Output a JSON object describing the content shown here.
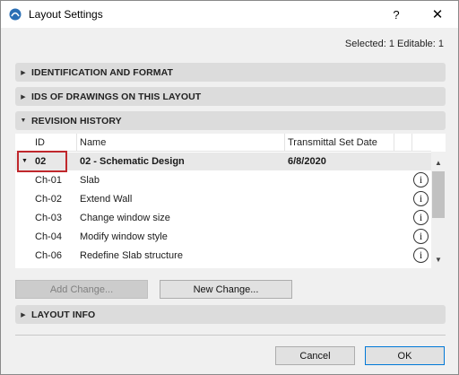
{
  "window": {
    "title": "Layout Settings",
    "help_label": "?",
    "close_label": "✕"
  },
  "selection_info": "Selected: 1 Editable: 1",
  "sections": [
    {
      "label": "IDENTIFICATION AND FORMAT",
      "expanded": false
    },
    {
      "label": "IDS OF DRAWINGS ON THIS LAYOUT",
      "expanded": false
    },
    {
      "label": "REVISION HISTORY",
      "expanded": true
    },
    {
      "label": "LAYOUT INFO",
      "expanded": false
    }
  ],
  "revision_table": {
    "columns": [
      "ID",
      "Name",
      "Transmittal Set Date"
    ],
    "group": {
      "id": "02",
      "name": "02 - Schematic Design",
      "date": "6/8/2020"
    },
    "rows": [
      {
        "id": "Ch-01",
        "name": "Slab"
      },
      {
        "id": "Ch-02",
        "name": "Extend Wall"
      },
      {
        "id": "Ch-03",
        "name": "Change window size"
      },
      {
        "id": "Ch-04",
        "name": "Modify window style"
      },
      {
        "id": "Ch-06",
        "name": "Redefine Slab structure"
      }
    ],
    "info_glyph": "i"
  },
  "buttons": {
    "add_change": "Add Change...",
    "new_change": "New Change...",
    "cancel": "Cancel",
    "ok": "OK"
  },
  "colors": {
    "highlight_border": "#c0282d",
    "primary_border": "#0078d7"
  }
}
